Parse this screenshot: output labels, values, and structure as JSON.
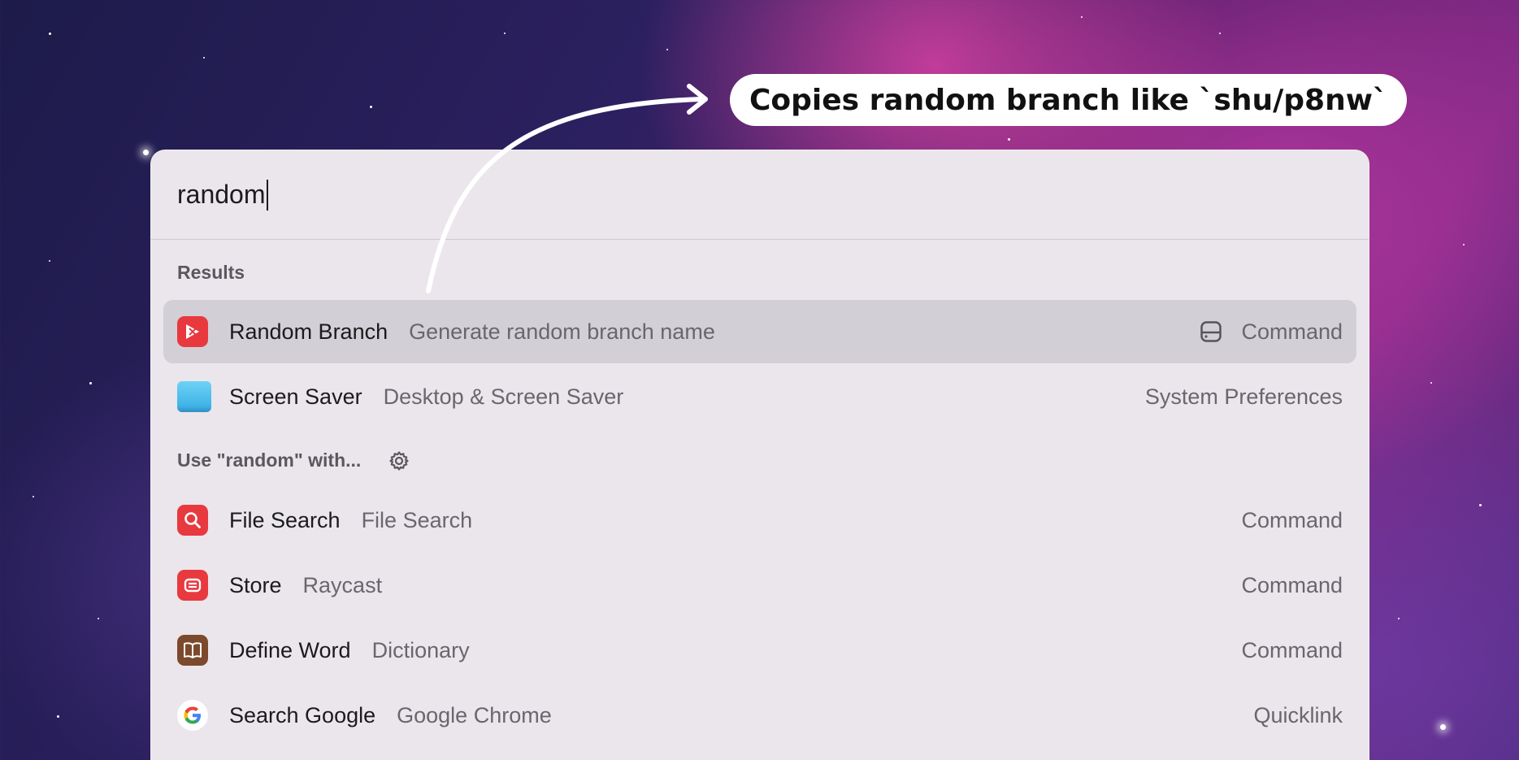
{
  "callout": {
    "text": "Copies random branch like `shu/p8nw`"
  },
  "search": {
    "value": "random"
  },
  "sections": {
    "results_title": "Results",
    "fallback_title": "Use \"random\" with..."
  },
  "results": [
    {
      "title": "Random Branch",
      "subtitle": "Generate random branch name",
      "accessory": "Command",
      "icon": "random-branch-icon",
      "selected": true
    },
    {
      "title": "Screen Saver",
      "subtitle": "Desktop & Screen Saver",
      "accessory": "System Preferences",
      "icon": "screen-saver-icon",
      "selected": false
    }
  ],
  "fallbacks": [
    {
      "title": "File Search",
      "subtitle": "File Search",
      "accessory": "Command",
      "icon": "file-search-icon"
    },
    {
      "title": "Store",
      "subtitle": "Raycast",
      "accessory": "Command",
      "icon": "store-icon"
    },
    {
      "title": "Define Word",
      "subtitle": "Dictionary",
      "accessory": "Command",
      "icon": "dictionary-icon"
    },
    {
      "title": "Search Google",
      "subtitle": "Google Chrome",
      "accessory": "Quicklink",
      "icon": "google-icon"
    }
  ],
  "colors": {
    "raycast_red": "#e8393f",
    "panel_bg": "#ebe6ec",
    "selected_bg": "#d3cfd6",
    "dictionary_brown": "#7b4a2c",
    "screen_saver_blue": "#4fc3ef"
  }
}
